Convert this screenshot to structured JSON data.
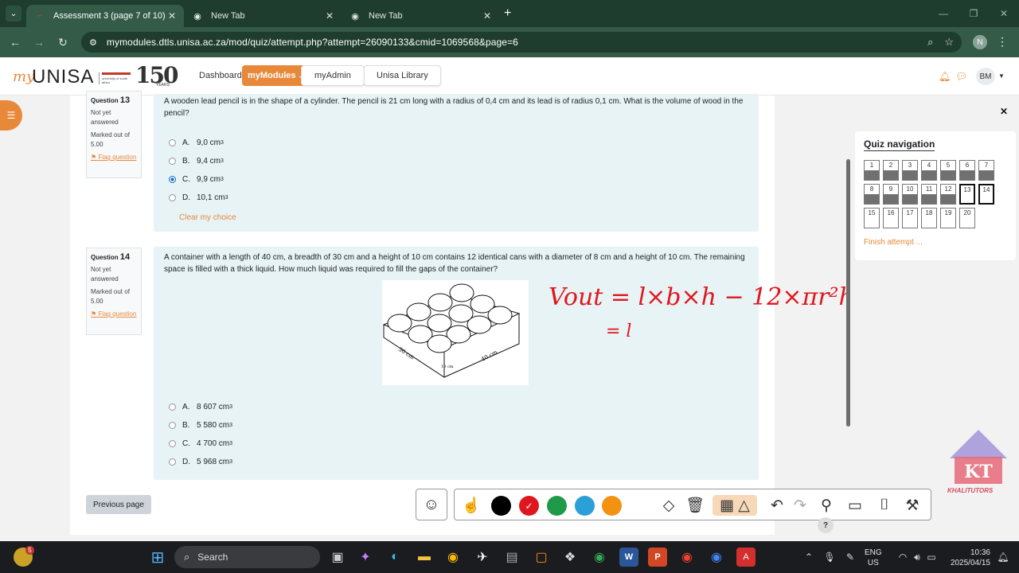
{
  "browser": {
    "tabs": [
      {
        "title": "Assessment 3 (page 7 of 10)",
        "active": true
      },
      {
        "title": "New Tab",
        "active": false
      },
      {
        "title": "New Tab",
        "active": false
      }
    ],
    "url": "mymodules.dtls.unisa.ac.za/mod/quiz/attempt.php?attempt=26090133&cmid=1069568&page=6",
    "profile_initial": "N"
  },
  "header": {
    "logo_my": "my",
    "logo_unisa": "UNISA",
    "logo_sub": "university of south africa",
    "logo_150": "150",
    "logo_years": "YEARS",
    "nav": {
      "dashboard": "Dashboard",
      "mymodules": "myModules",
      "myadmin": "myAdmin",
      "library": "Unisa Library"
    },
    "user_initials": "BM"
  },
  "questions": [
    {
      "label": "Question",
      "number": "13",
      "state": "Not yet answered",
      "marked": "Marked out of 5.00",
      "flag": "Flag question",
      "text": "A wooden lead pencil is in the shape of a cylinder. The pencil is 21 cm long with a radius of 0,4 cm and its lead is of radius 0,1 cm. What is the volume of wood in the pencil?",
      "options": [
        {
          "letter": "A.",
          "value": "9,0 cm",
          "sup": "3",
          "selected": false
        },
        {
          "letter": "B.",
          "value": "9,4 cm",
          "sup": "3",
          "selected": false
        },
        {
          "letter": "C.",
          "value": "9,9 cm",
          "sup": "3",
          "selected": true
        },
        {
          "letter": "D.",
          "value": "10,1 cm",
          "sup": "3",
          "selected": false
        }
      ],
      "clear": "Clear my choice"
    },
    {
      "label": "Question",
      "number": "14",
      "state": "Not yet answered",
      "marked": "Marked out of 5.00",
      "flag": "Flag question",
      "text": "A container with a length of 40 cm, a breadth of 30 cm and a height of 10 cm contains 12 identical cans with a diameter of 8 cm and a height of 10 cm. The remaining space is filled with a thick liquid. How much liquid was required to fill the gaps of the container?",
      "figure_labels": {
        "breadth": "30 cm",
        "height": "10 cm",
        "length": "40 cm"
      },
      "options": [
        {
          "letter": "A.",
          "value": "8 607 cm",
          "sup": "3",
          "selected": false
        },
        {
          "letter": "B.",
          "value": "5 580 cm",
          "sup": "3",
          "selected": false
        },
        {
          "letter": "C.",
          "value": "4 700 cm",
          "sup": "3",
          "selected": false
        },
        {
          "letter": "D.",
          "value": "5 968 cm",
          "sup": "3",
          "selected": false
        }
      ]
    }
  ],
  "handwriting": {
    "line1": "Vout = l×b×h − 12×πr²h",
    "line2": "= l"
  },
  "prev_button": "Previous page",
  "quiz_nav": {
    "title": "Quiz navigation",
    "buttons": [
      {
        "n": "1",
        "answered": true
      },
      {
        "n": "2",
        "answered": true
      },
      {
        "n": "3",
        "answered": true
      },
      {
        "n": "4",
        "answered": true
      },
      {
        "n": "5",
        "answered": true
      },
      {
        "n": "6",
        "answered": true
      },
      {
        "n": "7",
        "answered": true
      },
      {
        "n": "8",
        "answered": true
      },
      {
        "n": "9",
        "answered": true
      },
      {
        "n": "10",
        "answered": true
      },
      {
        "n": "11",
        "answered": true
      },
      {
        "n": "12",
        "answered": true
      },
      {
        "n": "13",
        "answered": false,
        "current": true
      },
      {
        "n": "14",
        "answered": false,
        "current": true
      },
      {
        "n": "15",
        "answered": false
      },
      {
        "n": "16",
        "answered": false
      },
      {
        "n": "17",
        "answered": false
      },
      {
        "n": "18",
        "answered": false
      },
      {
        "n": "19",
        "answered": false
      },
      {
        "n": "20",
        "answered": false
      }
    ],
    "finish": "Finish attempt ..."
  },
  "annotation_colors": [
    "#000000",
    "#e0161e",
    "#1f9a48",
    "#2a9fd8",
    "#f39211"
  ],
  "watermark": {
    "initials": "KT",
    "name": "KHALITUTORS"
  },
  "taskbar": {
    "search": "Search",
    "notif_badge": "5",
    "lang_top": "ENG",
    "lang_bottom": "US",
    "time": "10:36",
    "date": "2025/04/15"
  },
  "help": "?"
}
